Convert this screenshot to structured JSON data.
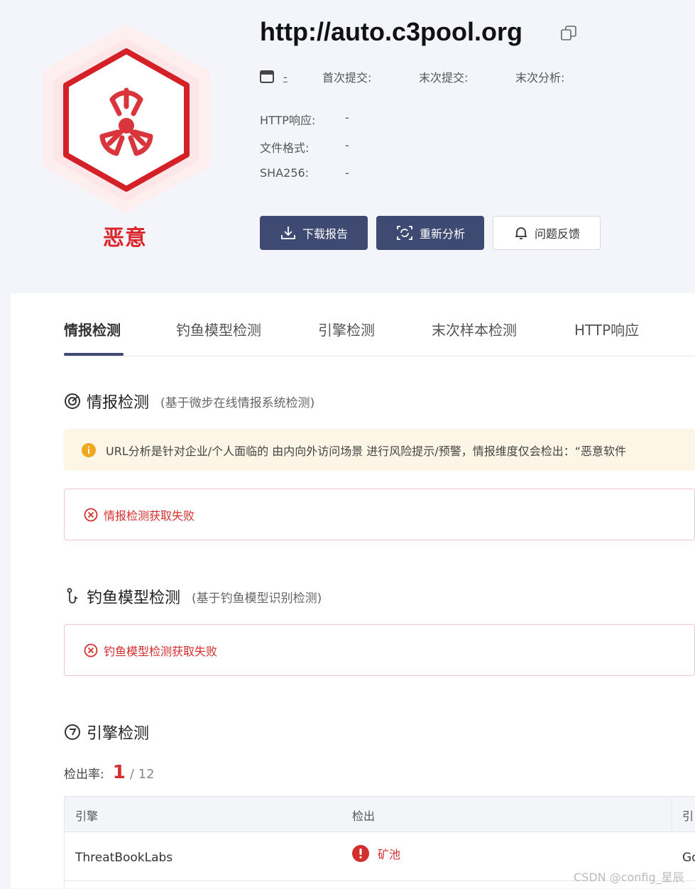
{
  "header": {
    "url": "http://auto.c3pool.org",
    "verdict": "恶意",
    "meta": {
      "type_value": "-",
      "first_submit_label": "首次提交:",
      "last_submit_label": "末次提交:",
      "last_analysis_label": "末次分析:"
    },
    "details": [
      {
        "label": "HTTP响应:",
        "value": "-"
      },
      {
        "label": "文件格式:",
        "value": "-"
      },
      {
        "label": "SHA256:",
        "value": "-"
      }
    ],
    "buttons": {
      "download": "下载报告",
      "reanalyze": "重新分析",
      "feedback": "问题反馈"
    }
  },
  "tabs": [
    "情报检测",
    "钓鱼模型检测",
    "引擎检测",
    "末次样本检测",
    "HTTP响应"
  ],
  "intel": {
    "title": "情报检测",
    "subtitle": "(基于微步在线情报系统检测)",
    "notice": "URL分析是针对企业/个人面临的 由内向外访问场景 进行风险提示/预警，情报维度仅会检出：“恶意软件",
    "error": "情报检测获取失败"
  },
  "phishing": {
    "title": "钓鱼模型检测",
    "subtitle": "(基于钓鱼模型识别检测)",
    "error": "钓鱼模型检测获取失败"
  },
  "engine": {
    "title": "引擎检测",
    "rate_label": "检出率:",
    "hits": "1",
    "total": "/ 12",
    "columns": [
      "引擎",
      "检出",
      "引"
    ],
    "rows": [
      {
        "engine": "ThreatBookLabs",
        "detection": "矿池",
        "next": "Go"
      }
    ]
  },
  "watermark": "CSDN @config_星辰",
  "colors": {
    "brand": "#3f4a72",
    "danger": "#d32f2f",
    "notice_bg": "#fdf6e6"
  }
}
